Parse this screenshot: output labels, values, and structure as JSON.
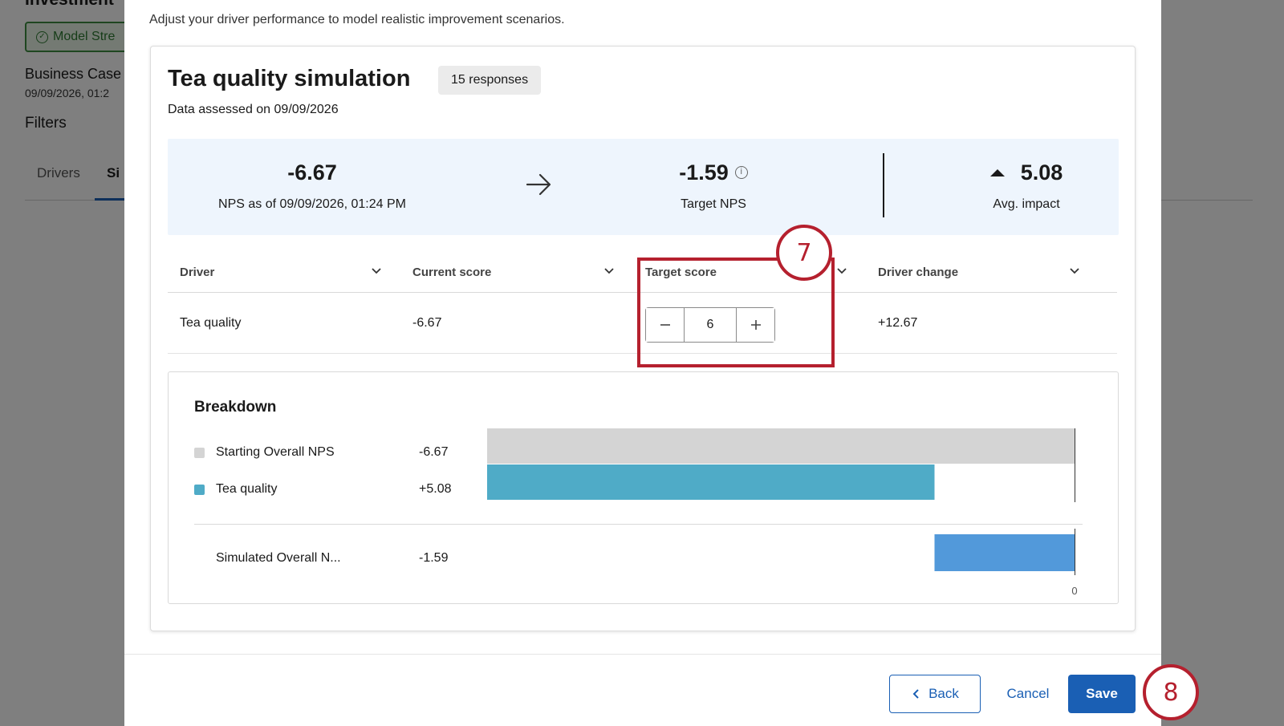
{
  "background": {
    "title": "Investment",
    "badge": "Model Stre",
    "case_name": "Business Case",
    "case_date": "09/09/2026, 01:2",
    "filters": "Filters",
    "tabs": [
      "Drivers",
      "Si"
    ]
  },
  "modal": {
    "description": "Adjust your driver performance to model realistic improvement scenarios.",
    "title": "Tea quality simulation",
    "responses": "15 responses",
    "assessed": "Data assessed on 09/09/2026"
  },
  "summary": {
    "current_value": "-6.67",
    "current_label": "NPS as of 09/09/2026, 01:24 PM",
    "target_value": "-1.59",
    "target_label": "Target NPS",
    "impact_value": "5.08",
    "impact_label": "Avg. impact"
  },
  "table": {
    "columns": [
      "Driver",
      "Current score",
      "Target score",
      "Driver change"
    ],
    "rows": [
      {
        "driver": "Tea quality",
        "current": "-6.67",
        "target": "6",
        "change": "+12.67"
      }
    ]
  },
  "breakdown": {
    "title": "Breakdown",
    "rows": [
      {
        "label": "Starting Overall NPS",
        "value": "-6.67"
      },
      {
        "label": "Tea quality",
        "value": "+5.08"
      },
      {
        "label": "Simulated Overall N...",
        "value": "-1.59"
      }
    ],
    "axis_tick": "0"
  },
  "chart_data": {
    "type": "bar",
    "categories": [
      "Starting Overall NPS",
      "Tea quality",
      "Simulated Overall N..."
    ],
    "values": [
      -6.67,
      5.08,
      -1.59
    ],
    "x_tick_labels": [
      "0"
    ],
    "colors": [
      "#d4d4d4",
      "#4fabc7",
      "#5299da"
    ]
  },
  "footer": {
    "back": "Back",
    "cancel": "Cancel",
    "save": "Save"
  },
  "annotations": {
    "step_target": "7",
    "step_save": "8"
  },
  "colors": {
    "primary": "#1a5fb4",
    "highlight": "#b5202e",
    "summary_bg": "#eef5fd"
  }
}
